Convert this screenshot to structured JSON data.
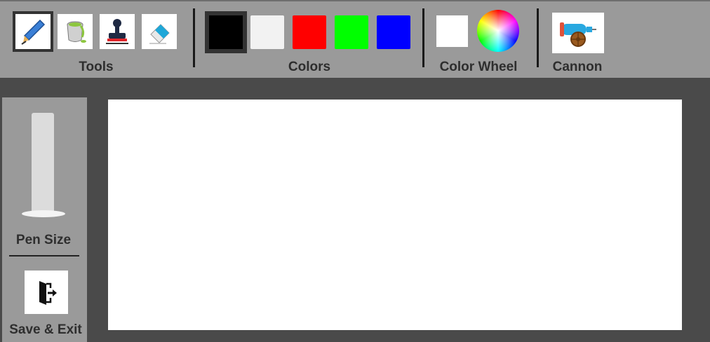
{
  "toolbar": {
    "groups": {
      "tools": "Tools",
      "colors": "Colors",
      "color_wheel": "Color Wheel",
      "cannon": "Cannon"
    },
    "tools": [
      {
        "name": "pen",
        "icon": "pen-icon",
        "selected": true
      },
      {
        "name": "paint-bucket",
        "icon": "paint-bucket-icon",
        "selected": false
      },
      {
        "name": "stamp",
        "icon": "stamp-icon",
        "selected": false
      },
      {
        "name": "eraser",
        "icon": "eraser-icon",
        "selected": false
      }
    ],
    "colors": [
      {
        "name": "black",
        "hex": "#000000",
        "selected": true
      },
      {
        "name": "white",
        "hex": "#f2f2f2",
        "selected": false
      },
      {
        "name": "red",
        "hex": "#ff0000",
        "selected": false
      },
      {
        "name": "green",
        "hex": "#00ff00",
        "selected": false
      },
      {
        "name": "blue",
        "hex": "#0000ff",
        "selected": false
      }
    ],
    "current_color": "#ffffff"
  },
  "sidebar": {
    "pen_size_label": "Pen Size",
    "pen_size_level": 0,
    "save_exit_label": "Save & Exit"
  }
}
